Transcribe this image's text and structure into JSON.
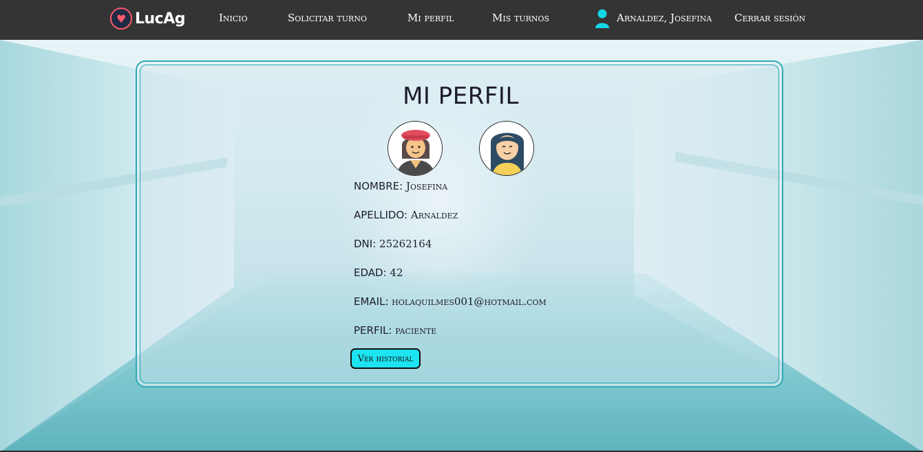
{
  "nav": {
    "brand": "LucAg",
    "links": [
      "Inicio",
      "Solicitar turno",
      "Mi perfil",
      "Mis turnos"
    ],
    "user_name": "Arnaldez, Josefina",
    "logout": "Cerrar sesión",
    "icons": [
      "heart-logo-icon",
      "user-icon"
    ]
  },
  "profile": {
    "title": "MI PERFIL",
    "avatars": [
      "doctor-avatar",
      "patient-avatar"
    ],
    "fields": [
      {
        "label": "NOMBRE:",
        "value": "Josefina"
      },
      {
        "label": "APELLIDO:",
        "value": "Arnaldez"
      },
      {
        "label": "DNI:",
        "value": "25262164"
      },
      {
        "label": "EDAD:",
        "value": "42"
      },
      {
        "label": "EMAIL:",
        "value": "holaquilmes001@hotmail.com"
      },
      {
        "label": "PERFIL:",
        "value": "paciente"
      }
    ],
    "history_button": "Ver historial"
  },
  "colors": {
    "navbar": "#343434",
    "accent": "#1ee3f0",
    "card_border": "#2fa8b4",
    "user_icon": "#14d6e6"
  }
}
